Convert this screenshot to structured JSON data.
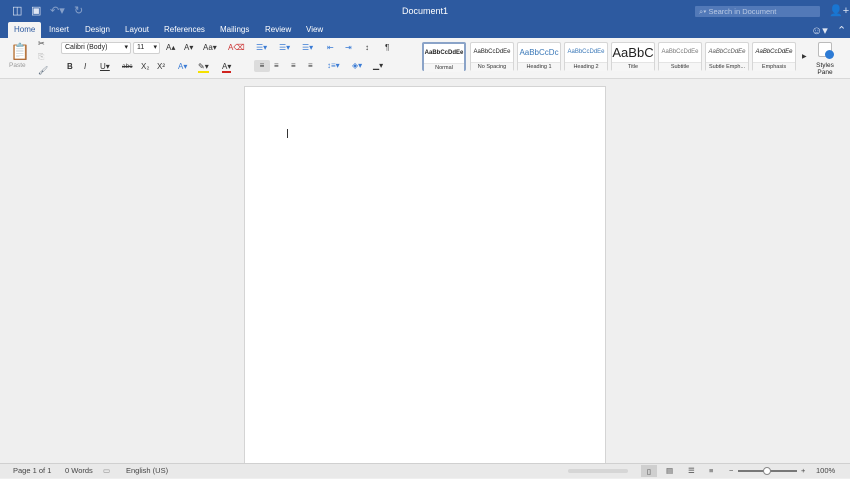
{
  "window": {
    "title": "Document1",
    "search_placeholder": "Search in Document"
  },
  "tabs": [
    "Home",
    "Insert",
    "Design",
    "Layout",
    "References",
    "Mailings",
    "Review",
    "View"
  ],
  "active_tab": "Home",
  "ribbon": {
    "paste_label": "Paste",
    "font_name": "Calibri (Body)",
    "font_size": "11",
    "styles": [
      {
        "preview": "AaBbCcDdEe",
        "label": "Normal",
        "selected": true
      },
      {
        "preview": "AaBbCcDdEe",
        "label": "No Spacing"
      },
      {
        "preview": "AaBbCcDc",
        "label": "Heading 1"
      },
      {
        "preview": "AaBbCcDdEe",
        "label": "Heading 2"
      },
      {
        "preview": "AaBbC",
        "label": "Title"
      },
      {
        "preview": "AaBbCcDdEe",
        "label": "Subtitle"
      },
      {
        "preview": "AaBbCcDdEe",
        "label": "Subtle Emph..."
      },
      {
        "preview": "AaBbCcDdEe",
        "label": "Emphasis"
      }
    ],
    "styles_pane_label": "Styles Pane"
  },
  "status": {
    "page": "Page 1 of 1",
    "words": "0 Words",
    "language": "English (US)",
    "zoom": "100%",
    "zoom_level_percent": 100
  },
  "colors": {
    "brand": "#2d5aa0",
    "highlight": "#f5e100",
    "font_color": "#d0231f"
  }
}
